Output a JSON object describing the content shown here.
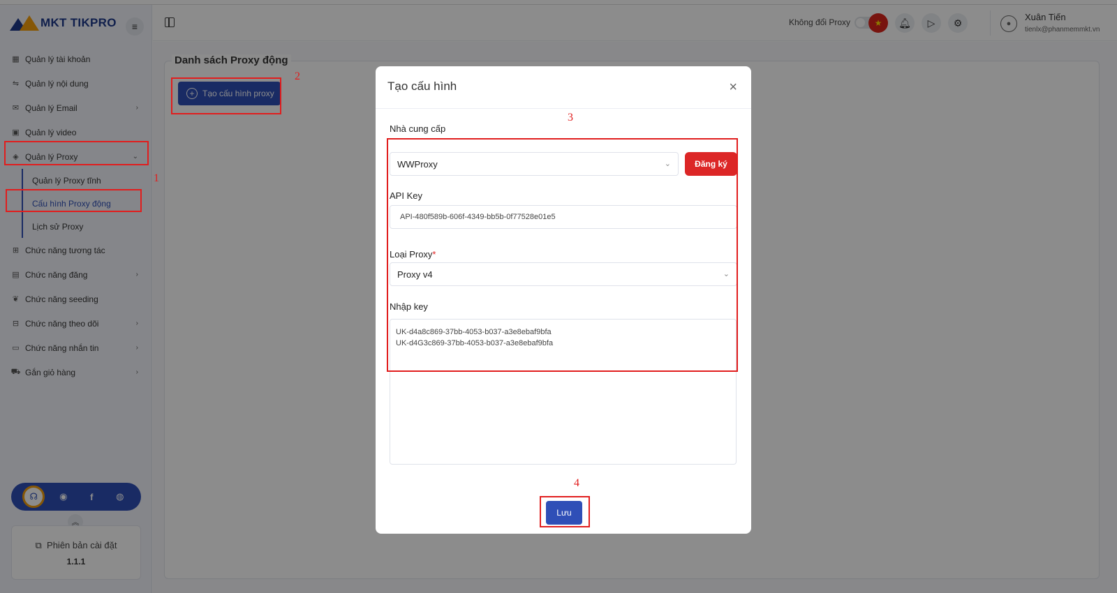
{
  "app": {
    "brand": "MKT TIKPRO"
  },
  "sidebar": {
    "items": [
      {
        "label": "Quản lý tài khoản",
        "icon": "grid-icon"
      },
      {
        "label": "Quản lý nội dung",
        "icon": "content-icon"
      },
      {
        "label": "Quản lý Email",
        "icon": "email-icon",
        "has_children": true
      },
      {
        "label": "Quản lý video",
        "icon": "video-icon"
      },
      {
        "label": "Quản lý Proxy",
        "icon": "layers-icon",
        "expanded": true
      },
      {
        "label": "Chức năng tương tác",
        "icon": "interact-icon"
      },
      {
        "label": "Chức năng đăng",
        "icon": "post-icon",
        "has_children": true
      },
      {
        "label": "Chức năng seeding",
        "icon": "seeding-icon"
      },
      {
        "label": "Chức năng theo dõi",
        "icon": "follow-icon",
        "has_children": true
      },
      {
        "label": "Chức năng nhắn tin",
        "icon": "message-icon",
        "has_children": true
      },
      {
        "label": "Gắn giỏ hàng",
        "icon": "cart-icon",
        "has_children": true
      }
    ],
    "proxy_subitems": [
      {
        "label": "Quản lý Proxy tĩnh",
        "active": false
      },
      {
        "label": "Cấu hình Proxy động",
        "active": true
      },
      {
        "label": "Lịch sử Proxy",
        "active": false
      }
    ],
    "version_label": "Phiên bản cài đặt",
    "version_number": "1.1.1"
  },
  "header": {
    "proxy_toggle_label": "Không đổi Proxy",
    "proxy_toggle_on": false,
    "user_name": "Xuân Tiến",
    "user_email": "tienlx@phanmemmkt.vn"
  },
  "main": {
    "panel_title": "Danh sách Proxy động",
    "create_button": "Tạo cấu hình proxy"
  },
  "modal": {
    "title": "Tạo cấu hình",
    "provider_label": "Nhà cung cấp",
    "provider_value": "WWProxy",
    "register_button": "Đăng ký",
    "api_key_label": "API Key",
    "api_key_value": "API-480f589b-606f-4349-bb5b-0f77528e01e5",
    "proxy_type_label": "Loại Proxy",
    "proxy_type_required": "*",
    "proxy_type_value": "Proxy v4",
    "key_input_label": "Nhập key",
    "key_lines": [
      "UK-d4a8c869-37bb-4053-b037-a3e8ebaf9bfa",
      "UK-d4G3c869-37bb-4053-b037-a3e8ebaf9bfa"
    ],
    "save_button": "Lưu"
  },
  "annotations": [
    "1",
    "2",
    "3",
    "4"
  ],
  "colors": {
    "primary": "#2f4fb7",
    "danger": "#dc2626",
    "annotation": "#e11d1d"
  }
}
